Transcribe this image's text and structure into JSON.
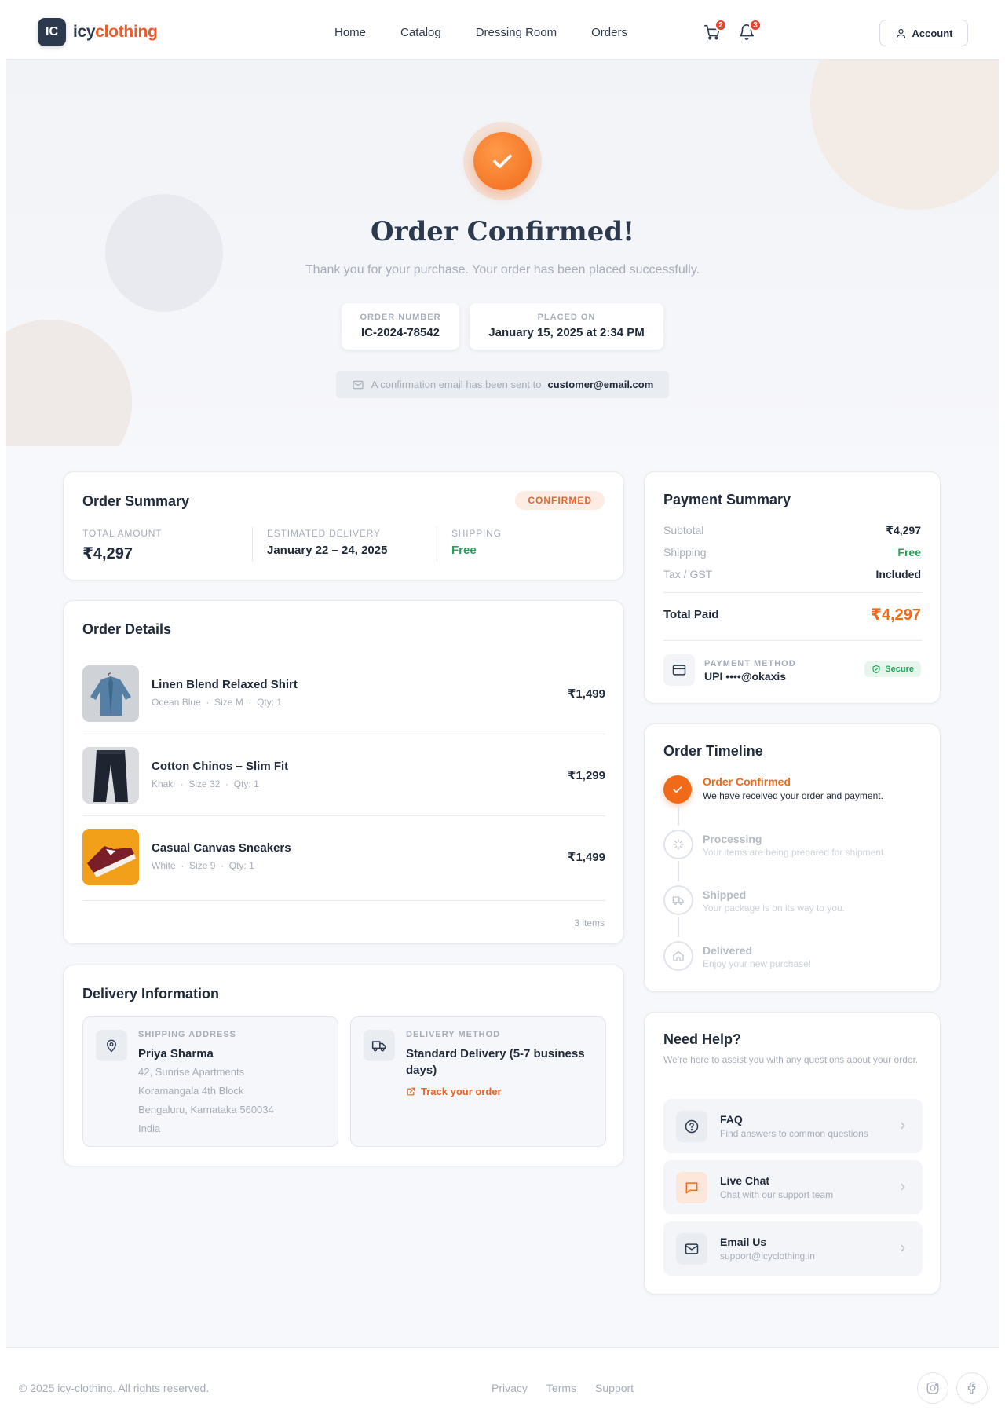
{
  "brand": {
    "badge": "IC",
    "name_part1": "icy",
    "name_part2": "clothing"
  },
  "nav": [
    "Home",
    "Catalog",
    "Dressing Room",
    "Orders"
  ],
  "header": {
    "cart_count": "2",
    "notification_count": "3",
    "account_label": "Account"
  },
  "hero": {
    "title": "Order Confirmed!",
    "subtitle": "Thank you for your purchase. Your order has been placed successfully.",
    "order_number_label": "ORDER NUMBER",
    "order_number": "IC-2024-78542",
    "placed_on_label": "PLACED ON",
    "placed_on": "January 15, 2025 at 2:34 PM",
    "email_note": "A confirmation email has been sent to",
    "email": "customer@email.com"
  },
  "order_summary": {
    "title": "Order Summary",
    "status": "CONFIRMED",
    "total_label": "TOTAL AMOUNT",
    "total": "₹4,297",
    "delivery_label": "ESTIMATED DELIVERY",
    "delivery": "January 22 – 24, 2025",
    "shipping_label": "SHIPPING",
    "shipping": "Free"
  },
  "order_details": {
    "title": "Order Details",
    "items": [
      {
        "name": "Linen Blend Relaxed Shirt",
        "color": "Ocean Blue",
        "size": "Size M",
        "qty": "Qty: 1",
        "price": "₹1,499"
      },
      {
        "name": "Cotton Chinos – Slim Fit",
        "color": "Khaki",
        "size": "Size 32",
        "qty": "Qty: 1",
        "price": "₹1,299"
      },
      {
        "name": "Casual Canvas Sneakers",
        "color": "White",
        "size": "Size 9",
        "qty": "Qty: 1",
        "price": "₹1,499"
      }
    ],
    "count": "3 items"
  },
  "delivery_info": {
    "title": "Delivery Information",
    "address_label": "SHIPPING ADDRESS",
    "name": "Priya Sharma",
    "address_lines": [
      "42, Sunrise Apartments",
      "Koramangala 4th Block",
      "Bengaluru, Karnataka 560034",
      "India"
    ],
    "method_label": "DELIVERY METHOD",
    "method": "Standard Delivery (5-7 business days)",
    "track_label": "Track your order"
  },
  "payment_summary": {
    "title": "Payment Summary",
    "subtotal_label": "Subtotal",
    "subtotal": "₹4,297",
    "shipping_label": "Shipping",
    "shipping": "Free",
    "tax_label": "Tax / GST",
    "tax": "Included",
    "total_label": "Total Paid",
    "total": "₹4,297",
    "method_label": "PAYMENT METHOD",
    "method": "UPI ••••@okaxis",
    "secure_label": "Secure"
  },
  "timeline": {
    "title": "Order Timeline",
    "steps": [
      {
        "title": "Order Confirmed",
        "desc": "We have received your order and payment."
      },
      {
        "title": "Processing",
        "desc": "Your items are being prepared for shipment."
      },
      {
        "title": "Shipped",
        "desc": "Your package is on its way to you."
      },
      {
        "title": "Delivered",
        "desc": "Enjoy your new purchase!"
      }
    ]
  },
  "help": {
    "title": "Need Help?",
    "subtitle": "We're here to assist you with any questions about your order.",
    "items": [
      {
        "title": "FAQ",
        "sub": "Find answers to common questions"
      },
      {
        "title": "Live Chat",
        "sub": "Chat with our support team"
      },
      {
        "title": "Email Us",
        "sub": "support@icyclothing.in"
      }
    ]
  },
  "footer": {
    "copyright": "© 2025 icy-clothing. All rights reserved.",
    "links": [
      "Privacy",
      "Terms",
      "Support"
    ]
  },
  "colors": {
    "accent": "#f06a1a",
    "navy": "#2d3a4e",
    "success": "#22a35a",
    "muted": "#a6adb8"
  }
}
